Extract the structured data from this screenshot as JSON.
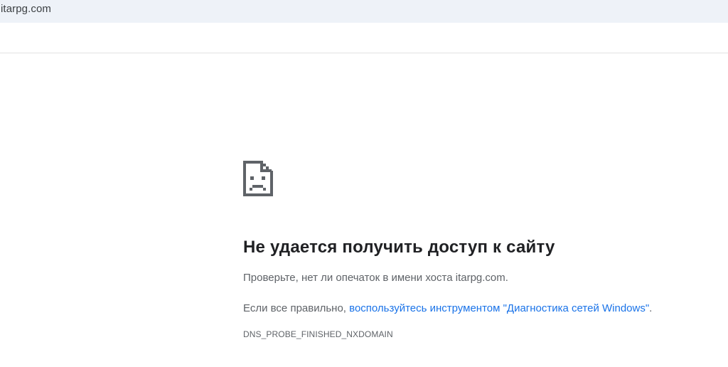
{
  "address_bar": {
    "url": "itarpg.com"
  },
  "error_page": {
    "icon": "sad-page-icon",
    "heading": "Не удается получить доступ к сайту",
    "line1": "Проверьте, нет ли опечаток в имени хоста itarpg.com.",
    "line2_prefix": "Если все правильно, ",
    "line2_link": "воспользуйтесь инструментом \"Диагностика сетей Windows\"",
    "line2_suffix": ".",
    "error_code": "DNS_PROBE_FINISHED_NXDOMAIN",
    "link_color": "#1a73e8",
    "text_color": "#5f6368",
    "heading_color": "#202124"
  }
}
